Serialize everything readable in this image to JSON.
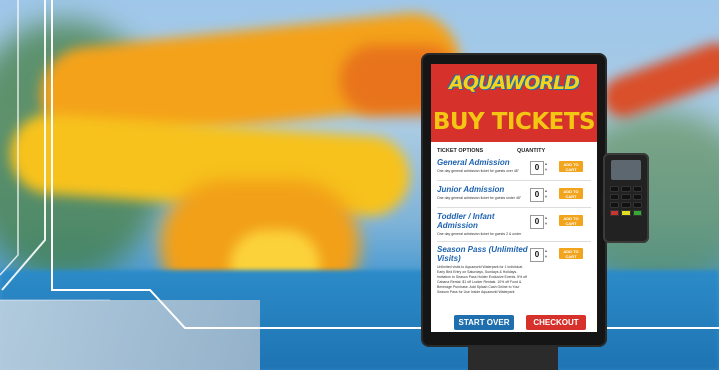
{
  "kiosk": {
    "logo": "AQUAWORLD",
    "heading": "BUY TICKETS",
    "columns": {
      "options": "TICKET OPTIONS",
      "quantity": "QUANTITY"
    },
    "tickets": [
      {
        "title": "General Admission",
        "description": "One day general admission ticket for guests over 48\"",
        "quantity": "0",
        "button": "ADD TO CART"
      },
      {
        "title": "Junior Admission",
        "description": "One day general admission ticket for guests under 48\"",
        "quantity": "0",
        "button": "ADD TO CART"
      },
      {
        "title": "Toddler / Infant Admission",
        "description": "One day general admission ticket for guests 2 & under",
        "quantity": "0",
        "button": "ADD TO CART"
      },
      {
        "title": "Season Pass (Unlimited Visits)",
        "description": "Unlimited visits to Aquaworld Waterpark for 1 individual. Early Bird Entry on Saturdays, Sundays & Holidays. Invitation to Season Pass Holder Exclusive Events. 5% off Cabana Rental. $1 off Locker Rentals. 10% off Food & Beverage Purchase. Add Splash Cash Online to Your Season Pass for Use Inside Aquaworld Waterpark",
        "quantity": "0",
        "button": "ADD TO CART"
      }
    ],
    "start_over": "START OVER",
    "checkout": "CHECKOUT"
  },
  "colors": {
    "banner": "#d7312c",
    "heading": "#f3c613",
    "title": "#1e63b0",
    "add_button": "#f2a41c",
    "start_button": "#1f6fae",
    "checkout_button": "#d7312c"
  }
}
